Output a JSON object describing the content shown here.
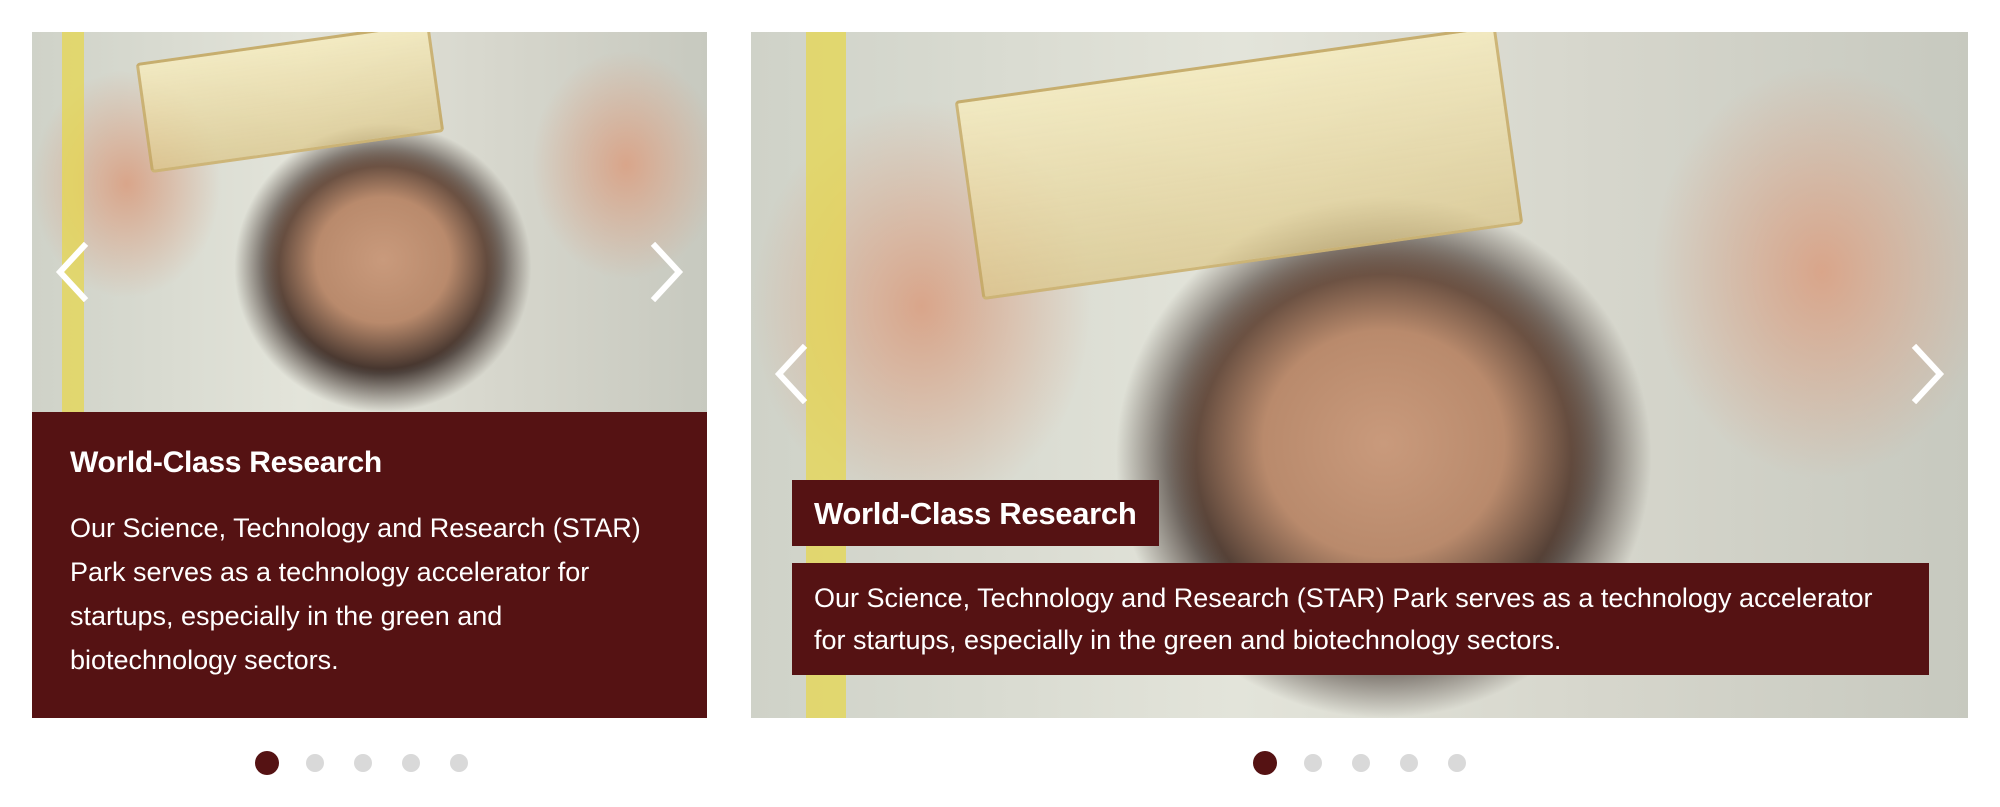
{
  "carousels": [
    {
      "title": "World-Class Research",
      "description": "Our Science, Technology and Research (STAR) Park serves as a technology accelerator for startups, especially in the green and biotechnology sectors.",
      "prev_icon": "chevron-left-icon",
      "next_icon": "chevron-right-icon",
      "dots_total": 5,
      "active_dot": 1
    },
    {
      "title": "World-Class Research",
      "description": "Our Science, Technology and Research (STAR) Park serves as a technology accelerator for startups, especially in the green and biotechnology sectors.",
      "prev_icon": "chevron-left-icon",
      "next_icon": "chevron-right-icon",
      "dots_total": 5,
      "active_dot": 1
    }
  ],
  "colors": {
    "caption_bg": "#551213",
    "dot_inactive": "#d9d9d9",
    "dot_active": "#551213"
  }
}
